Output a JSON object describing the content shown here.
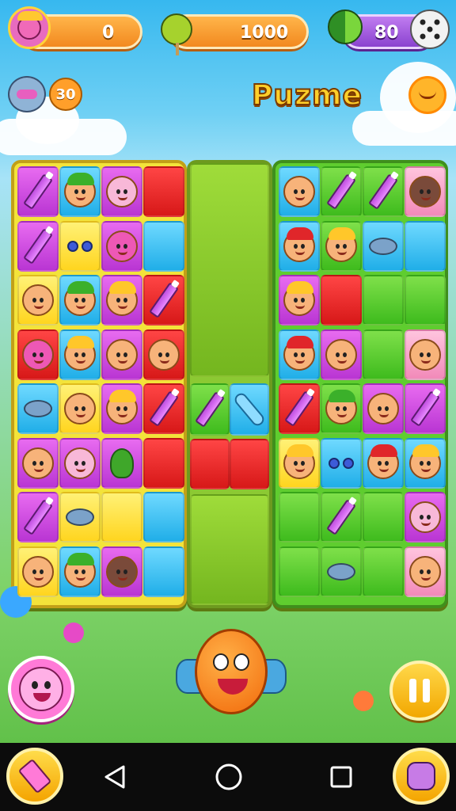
{
  "hud": {
    "lives_value": "0",
    "coins_value": "1000",
    "moves_value": "80",
    "booster_count": "30"
  },
  "title": "Puzme",
  "icons": {
    "lives": "face-avatar-icon",
    "coins": "lollipop-icon",
    "moves": "leaf-icon",
    "dice": "dice-icon",
    "booster": "gadget-icon",
    "sun": "sun-icon",
    "pause": "pause-icon",
    "eraser": "eraser-icon",
    "character": "smiley-candy-icon",
    "back": "back-icon",
    "home": "home-icon",
    "recent": "recent-apps-icon"
  },
  "colors": {
    "pink": "#d24ee6",
    "blue": "#29b6f0",
    "red": "#e52121",
    "yellow": "#ffe03a",
    "green": "#5fcd2f",
    "board": "#9ccf2d",
    "title": "#ffcf2a"
  },
  "boards": {
    "left": [
      [
        "pink-pencil",
        "blue-face-green-hat",
        "pink-pig",
        "red"
      ],
      [
        "pink-pencil",
        "yellow-flowers",
        "pink-ninja",
        "blue"
      ],
      [
        "yellow-face",
        "blue-face-green-hat",
        "pink-face-yellow-hat",
        "red-pencil"
      ],
      [
        "red-ninja",
        "blue-face-yellow-hat",
        "pink-face",
        "red-face"
      ],
      [
        "blue-gadget",
        "yellow-face",
        "pink-face-yellow-hat",
        "red-pencil"
      ],
      [
        "pink-face",
        "pink-pig",
        "pink-tree",
        "red"
      ],
      [
        "pink-pencil",
        "yellow-gadget",
        "yellow",
        "blue"
      ],
      [
        "yellow-face",
        "blue-face-green-hat",
        "pink-bear",
        "blue"
      ]
    ],
    "center": [
      "green-block",
      "purple-pencil",
      "blue-pill",
      "red",
      "red",
      "green-block"
    ],
    "right": [
      [
        "blue-face",
        "green-pencil",
        "green-pencil",
        "rose-bear"
      ],
      [
        "blue-face-red-hat",
        "green-face-yellow-hat",
        "blue-gadget",
        "blue"
      ],
      [
        "pink-face-yellow-hat",
        "red",
        "green",
        "green"
      ],
      [
        "blue-face-red-hat",
        "pink-face",
        "green",
        "rose-face"
      ],
      [
        "red-pencil",
        "green-face-green-hat",
        "pink-face",
        "pink-pencil"
      ],
      [
        "yellow-face-yellow-hat",
        "blue-flowers",
        "blue-face-red-hat",
        "blue-face-yellow-hat"
      ],
      [
        "green",
        "green-pencil",
        "green",
        "pink-pig"
      ],
      [
        "green",
        "green-gadget",
        "green",
        "rose-face"
      ]
    ]
  }
}
